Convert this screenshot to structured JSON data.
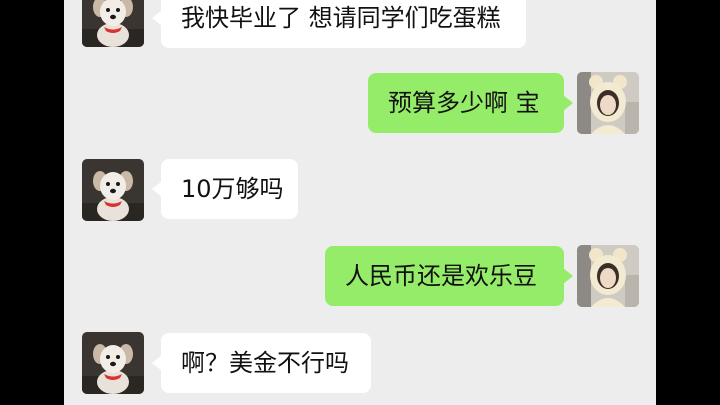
{
  "colors": {
    "letterbox": "#000000",
    "chat_background": "#ededed",
    "incoming_bubble": "#ffffff",
    "outgoing_bubble": "#95ec69",
    "text": "#111111"
  },
  "contacts": {
    "friend": {
      "avatar_icon": "white-puppy-avatar"
    },
    "self": {
      "avatar_icon": "girl-bear-hood-avatar"
    }
  },
  "messages": [
    {
      "sender": "friend",
      "text": "我快毕业了 想请同学们吃蛋糕"
    },
    {
      "sender": "self",
      "text": "预算多少啊 宝"
    },
    {
      "sender": "friend",
      "text": "10万够吗"
    },
    {
      "sender": "self",
      "text": "人民币还是欢乐豆"
    },
    {
      "sender": "friend",
      "text": "啊？美金不行吗"
    }
  ]
}
